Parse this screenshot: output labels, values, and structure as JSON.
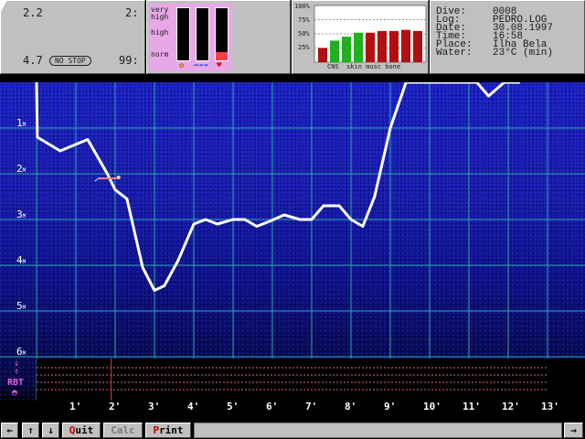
{
  "stats": {
    "depth_max": "2.2",
    "time_now": "2:",
    "depth_avg": "4.7",
    "no_stop": "NO STOP",
    "time_total": "99:"
  },
  "ascent": {
    "very_high": "very\nhigh",
    "high": "high",
    "norm": "norm",
    "bar_levels": [
      0.0,
      0.0,
      0.15
    ]
  },
  "tissue": {
    "y_ticks": [
      "100%",
      "75%",
      "50%",
      "25%"
    ],
    "labels": "CNS  skin musc bone",
    "bars": [
      {
        "value": 0.25,
        "color": "#b01010"
      },
      {
        "value": 0.38,
        "color": "#20b020"
      },
      {
        "value": 0.45,
        "color": "#20b020"
      },
      {
        "value": 0.52,
        "color": "#20b020"
      },
      {
        "value": 0.52,
        "color": "#b01010"
      },
      {
        "value": 0.55,
        "color": "#b01010"
      },
      {
        "value": 0.55,
        "color": "#b01010"
      },
      {
        "value": 0.57,
        "color": "#b01010"
      },
      {
        "value": 0.55,
        "color": "#b01010"
      }
    ]
  },
  "info": {
    "dive_label": "Dive:",
    "dive": "0008",
    "log_label": "Log:",
    "log": "PEDRO.LOG",
    "date_label": "Date:",
    "date": "30.08.1997",
    "time_label": "Time:",
    "time": "16:58",
    "place_label": "Place:",
    "place": "Ilha Bela",
    "water_label": "Water:",
    "water": "23°C (min)"
  },
  "profile": {
    "x_ticks": [
      "1'",
      "2'",
      "3'",
      "4'",
      "5'",
      "6'",
      "7'",
      "8'",
      "9'",
      "10'",
      "11'",
      "12'",
      "13'"
    ],
    "y_ticks": [
      "1",
      "2",
      "3",
      "4",
      "5",
      "6"
    ],
    "y_unit": "M",
    "rbt_label": "RBT",
    "x_max_min": 14,
    "y_max_m": 6,
    "points": [
      [
        0.0,
        0.0
      ],
      [
        0.02,
        1.2
      ],
      [
        0.6,
        1.5
      ],
      [
        1.3,
        1.25
      ],
      [
        1.8,
        2.0
      ],
      [
        2.0,
        2.35
      ],
      [
        2.3,
        2.55
      ],
      [
        2.7,
        4.05
      ],
      [
        3.0,
        4.55
      ],
      [
        3.25,
        4.45
      ],
      [
        3.6,
        3.9
      ],
      [
        4.0,
        3.1
      ],
      [
        4.3,
        3.0
      ],
      [
        4.6,
        3.1
      ],
      [
        5.0,
        3.0
      ],
      [
        5.3,
        3.0
      ],
      [
        5.6,
        3.15
      ],
      [
        5.9,
        3.05
      ],
      [
        6.3,
        2.9
      ],
      [
        6.7,
        3.0
      ],
      [
        7.0,
        3.0
      ],
      [
        7.3,
        2.7
      ],
      [
        7.7,
        2.7
      ],
      [
        8.0,
        3.0
      ],
      [
        8.3,
        3.15
      ],
      [
        8.6,
        2.5
      ],
      [
        9.0,
        1.0
      ],
      [
        9.4,
        0.0
      ],
      [
        10.0,
        0.0
      ],
      [
        11.2,
        0.0
      ],
      [
        11.5,
        0.3
      ],
      [
        11.9,
        0.0
      ],
      [
        12.3,
        0.0
      ]
    ],
    "diver_at_min": 1.9,
    "diver_at_m": 2.1,
    "time_marker_min": 1.9
  },
  "toolbar": {
    "left_arrow": "←",
    "up_arrow": "↑",
    "down_arrow": "↓",
    "quit": "Quit",
    "calc": "Calc",
    "print": "Print",
    "right_arrow": "→"
  }
}
